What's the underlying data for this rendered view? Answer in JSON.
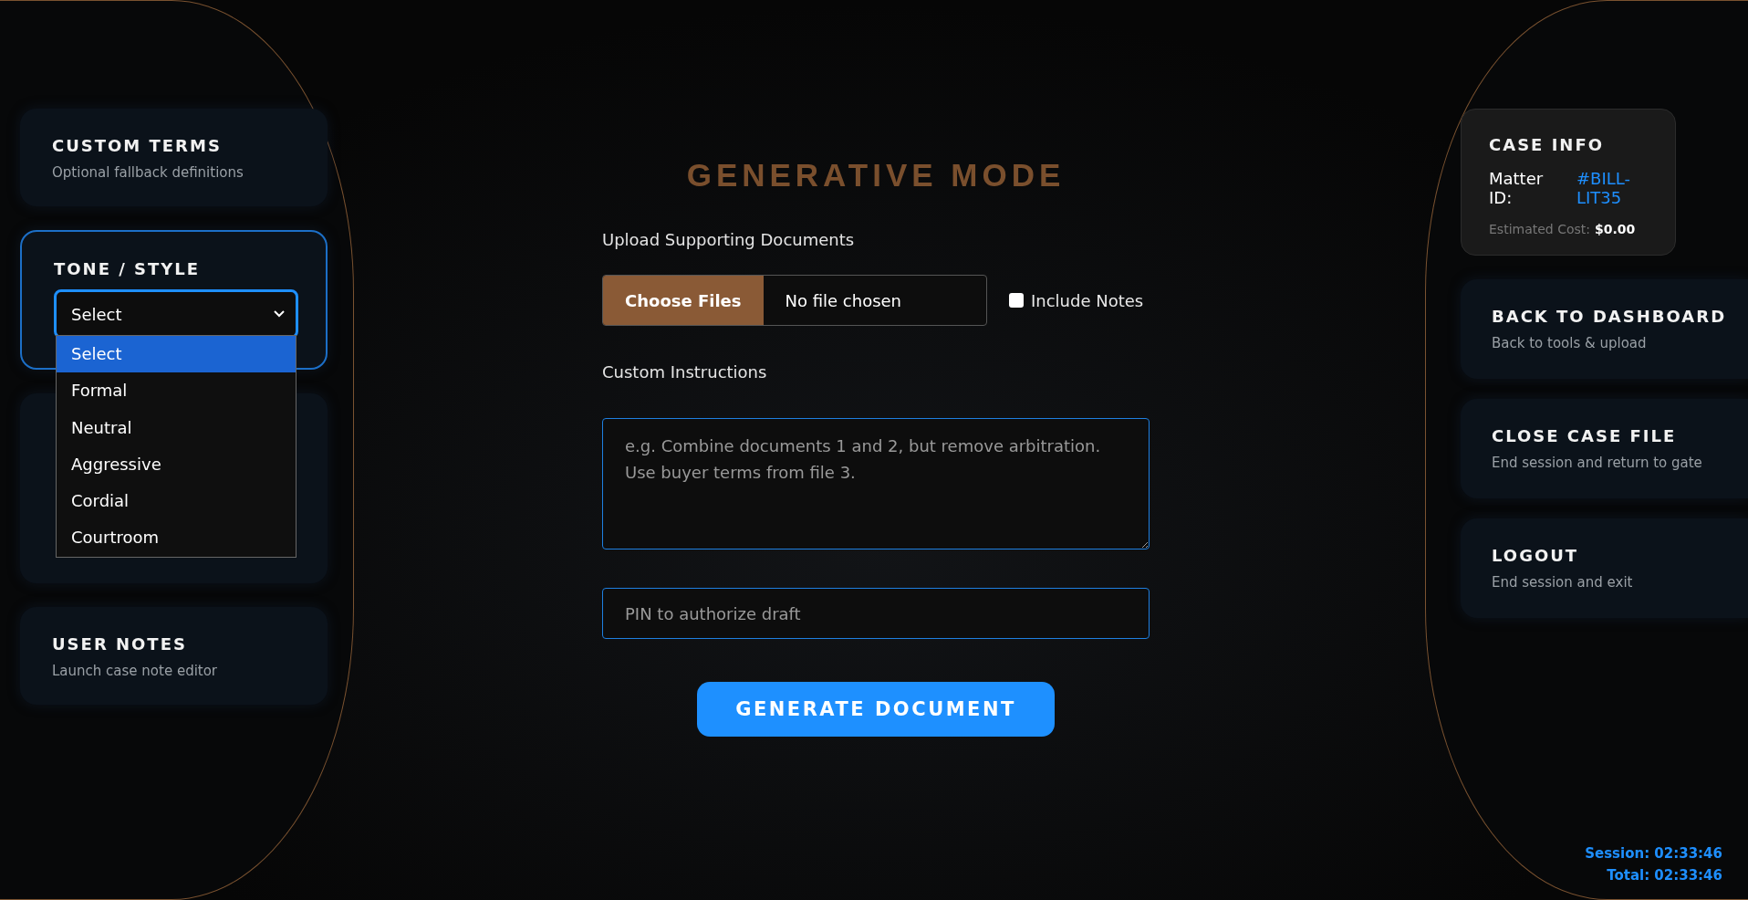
{
  "left_panel": {
    "cards": [
      {
        "kind": "link",
        "title": "CUSTOM TERMS",
        "subtitle": "Optional fallback definitions"
      },
      {
        "kind": "select",
        "title": "TONE / STYLE",
        "value": "Select",
        "expanded": true,
        "options": [
          {
            "label": "Select",
            "selected": true
          },
          {
            "label": "Formal",
            "selected": false
          },
          {
            "label": "Neutral",
            "selected": false
          },
          {
            "label": "Aggressive",
            "selected": false
          },
          {
            "label": "Cordial",
            "selected": false
          },
          {
            "label": "Courtroom",
            "selected": false
          }
        ]
      },
      {
        "kind": "blank"
      },
      {
        "kind": "link",
        "title": "USER NOTES",
        "subtitle": "Launch case note editor"
      }
    ]
  },
  "main": {
    "title": "GENERATIVE MODE",
    "upload_label": "Upload Supporting Documents",
    "file_button": "Choose Files",
    "file_status": "No file chosen",
    "include_notes": {
      "label": "Include Notes",
      "checked": false
    },
    "instructions_label": "Custom Instructions",
    "instructions_placeholder": "e.g. Combine documents 1 and 2, but remove arbitration. Use buyer terms from file 3.",
    "pin_placeholder": "PIN to authorize draft",
    "generate_button": "GENERATE DOCUMENT"
  },
  "right_panel": {
    "case_info": {
      "title": "CASE INFO",
      "matter_label": "Matter ID:",
      "matter_id": "#BILL-LIT35",
      "cost_label": "Estimated Cost:",
      "cost": "$0.00"
    },
    "cards": [
      {
        "title": "BACK TO DASHBOARD",
        "subtitle": "Back to tools & upload"
      },
      {
        "title": "CLOSE CASE FILE",
        "subtitle": "End session and return to gate"
      },
      {
        "title": "LOGOUT",
        "subtitle": "End session and exit"
      }
    ]
  },
  "timers": {
    "session": "Session: 02:33:46",
    "total": "Total: 02:33:46"
  }
}
